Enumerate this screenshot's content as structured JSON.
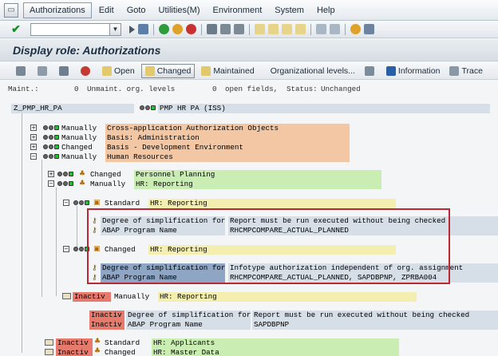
{
  "menubar": {
    "items": [
      "Authorizations",
      "Edit",
      "Goto",
      "Utilities(M)",
      "Environment",
      "System",
      "Help"
    ]
  },
  "title": "Display role: Authorizations",
  "apptoolbar": {
    "open": "Open",
    "changed": "Changed",
    "maintained": "Maintained",
    "org_levels": "Organizational levels...",
    "information": "Information",
    "trace": "Trace"
  },
  "info": {
    "maint_label": "Maint.:",
    "unmaint_count": "0",
    "unmaint_label": "Unmaint. org. levels",
    "open_count": "0",
    "open_label": "open fields,",
    "status_label": "Status:",
    "status_value": "Unchanged"
  },
  "root": {
    "name": "Z_PMP_HR_PA",
    "desc": "PMP HR PA (ISS)"
  },
  "tree": {
    "r1": {
      "status": "Manually",
      "text": "Cross-application Authorization Objects"
    },
    "r2": {
      "status": "Manually",
      "text": "Basis: Administration"
    },
    "r3": {
      "status": "Changed",
      "text": "Basis - Development Environment"
    },
    "r4": {
      "status": "Manually",
      "text": "Human Resources"
    },
    "r5": {
      "status": "Changed",
      "text": "Personnel Planning"
    },
    "r6": {
      "status": "Manually",
      "text": "HR: Reporting"
    },
    "r7": {
      "status": "Standard",
      "text": "HR: Reporting"
    },
    "r8": {
      "field": "Degree of simplification for a",
      "value": "Report must be run executed without being checked"
    },
    "r9": {
      "field": "ABAP Program Name",
      "value": "RHCMPCOMPARE_ACTUAL_PLANNED"
    },
    "r10": {
      "status": "Changed",
      "text": "HR: Reporting"
    },
    "r11": {
      "field": "Degree of simplification for a",
      "value": "Infotype authorization independent of org. assignment"
    },
    "r12": {
      "field": "ABAP Program Name",
      "value": "RHCMPCOMPARE_ACTUAL_PLANNED, SAPDBPNP, ZPRBA004"
    },
    "r13": {
      "flag": "Inactiv",
      "status": "Manually",
      "text": "HR: Reporting"
    },
    "r14": {
      "flag": "Inactiv",
      "field": "Degree of simplification for a",
      "value": "Report must be run executed without being checked"
    },
    "r15": {
      "flag": "Inactiv",
      "field": "ABAP Program Name",
      "value": "SAPDBPNP"
    },
    "r16": {
      "flag": "Inactiv",
      "status": "Standard",
      "text": "HR: Applicants"
    },
    "r17": {
      "flag": "Inactiv",
      "status": "Changed",
      "text": "HR: Master Data"
    }
  },
  "colors": {
    "orange": "#f3c7a4",
    "green": "#c9edb3",
    "yellow": "#f4eeb0",
    "blue_grey": "#d6dee8",
    "highlight": "#8ea6c4",
    "inactive_red": "#e67a6c",
    "frame_red": "#b82835"
  }
}
